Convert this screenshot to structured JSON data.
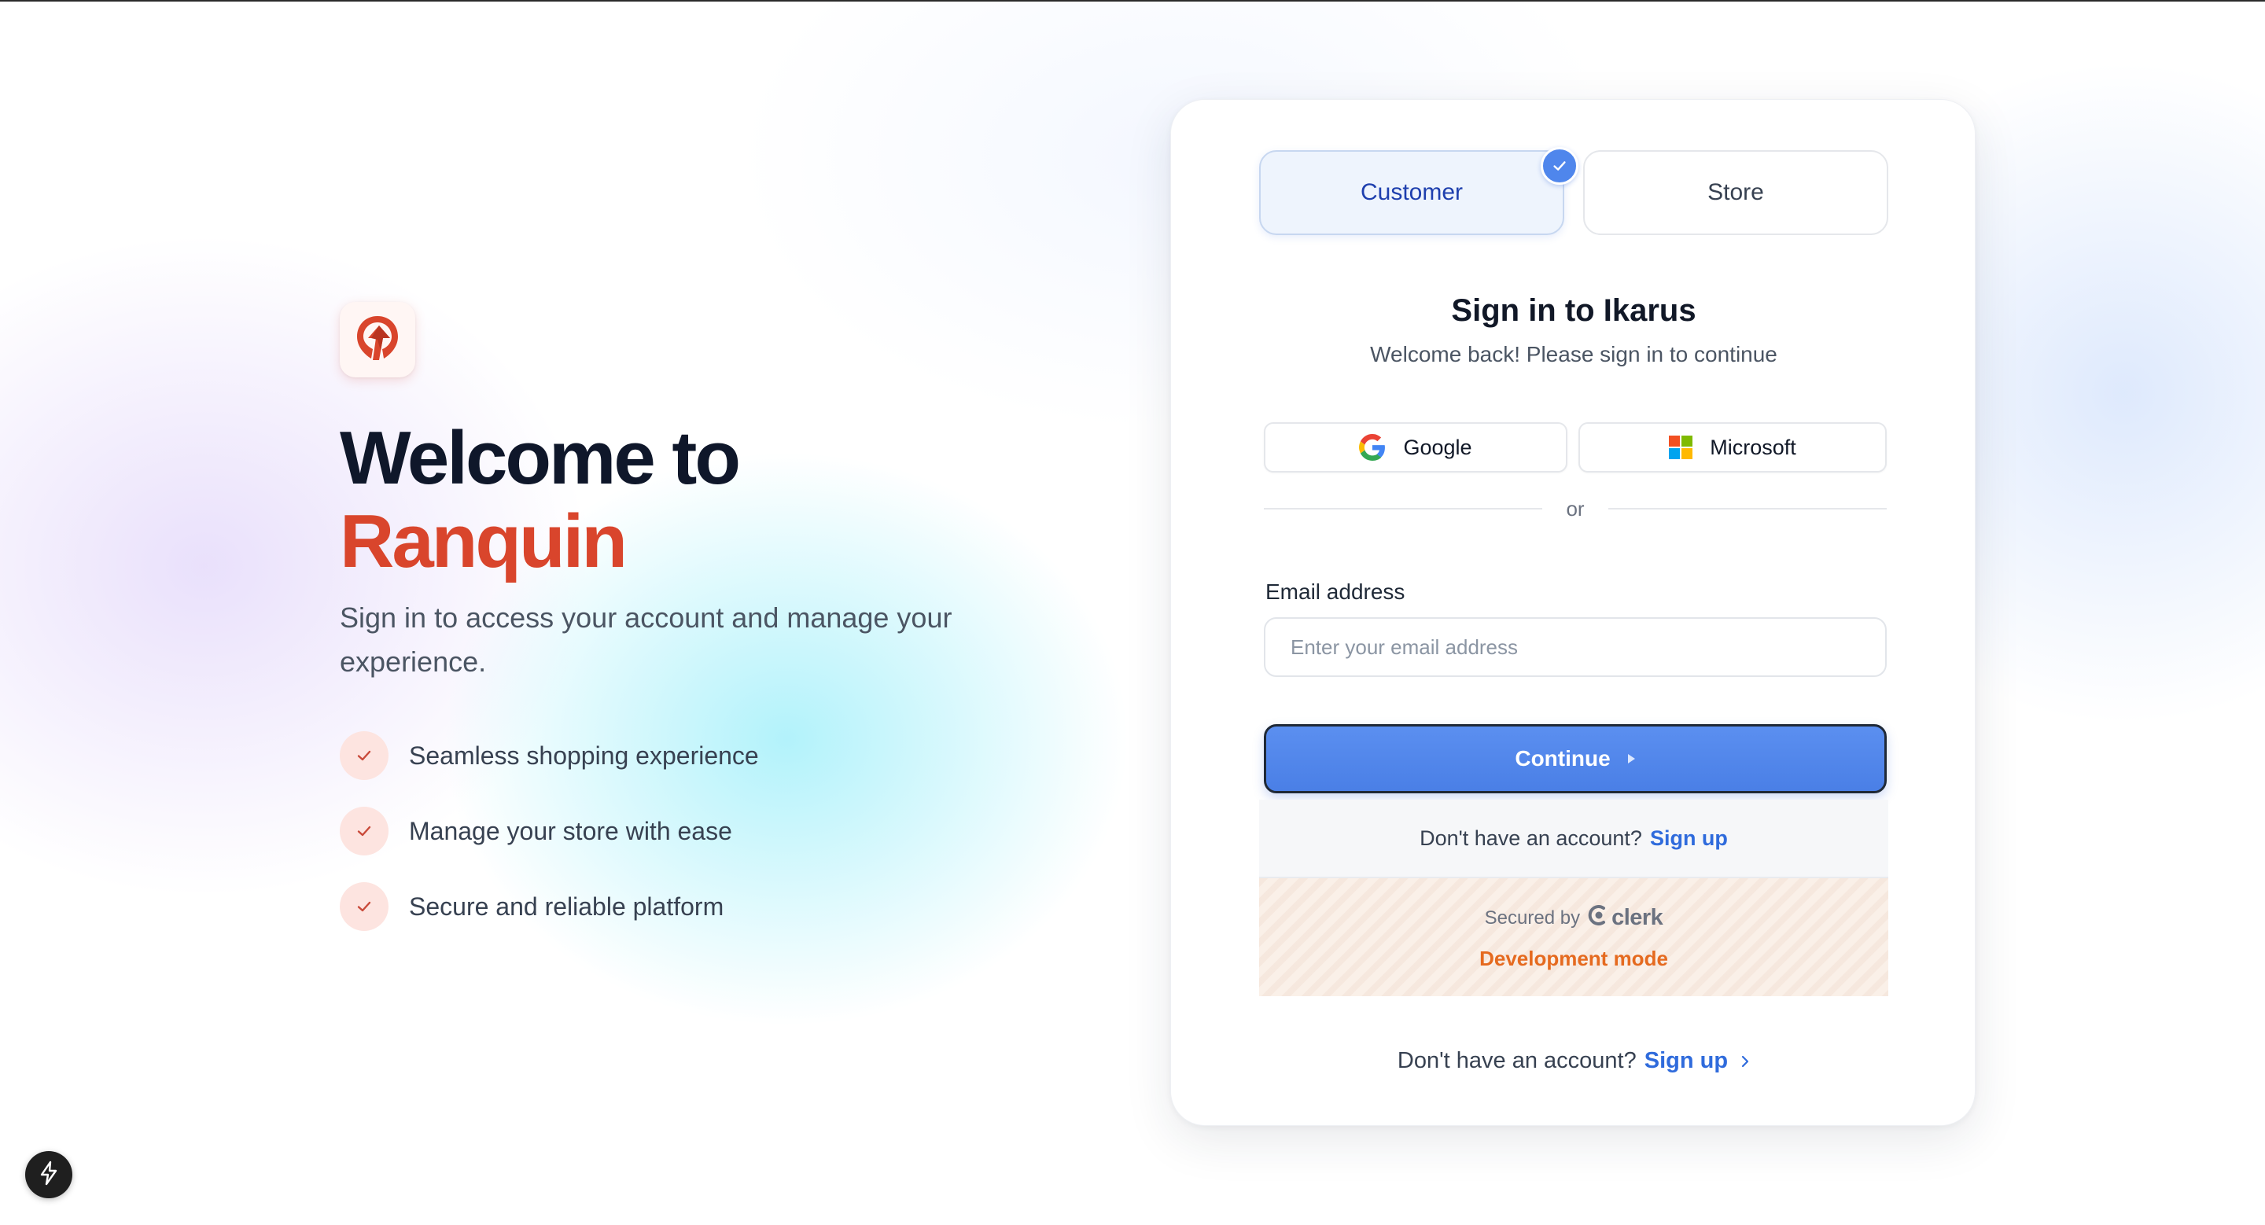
{
  "hero": {
    "headline_line1": "Welcome to",
    "brand_name": "Ranquin",
    "subtitle": "Sign in to access your account and manage your experience.",
    "features": [
      "Seamless shopping experience",
      "Manage your store with ease",
      "Secure and reliable platform"
    ]
  },
  "role_selector": {
    "options": [
      "Customer",
      "Store"
    ],
    "selected": "Customer"
  },
  "signin": {
    "title": "Sign in to Ikarus",
    "subtitle": "Welcome back! Please sign in to continue",
    "social": {
      "google_label": "Google",
      "microsoft_label": "Microsoft"
    },
    "divider_text": "or",
    "email_label": "Email address",
    "email_placeholder": "Enter your email address",
    "email_value": "",
    "continue_label": "Continue",
    "footer_prompt": "Don't have an account?",
    "footer_link": "Sign up",
    "secured_by": "Secured by",
    "secured_brand": "clerk",
    "dev_mode": "Development mode"
  },
  "bottom": {
    "prompt": "Don't have an account?",
    "link": "Sign up"
  },
  "colors": {
    "brand": "#d9452c",
    "accent": "#4f86ec",
    "link": "#2f6bdc",
    "dev_mode": "#e56a1f"
  },
  "icons": {
    "logo": "ranquin-logo-icon",
    "feature_check": "check-icon",
    "selected_check": "check-icon",
    "google": "google-icon",
    "microsoft": "microsoft-icon",
    "continue_arrow": "triangle-right-icon",
    "clerk": "clerk-logo-icon",
    "bottom_chevron": "chevron-right-icon",
    "dev_tools": "bolt-icon"
  }
}
